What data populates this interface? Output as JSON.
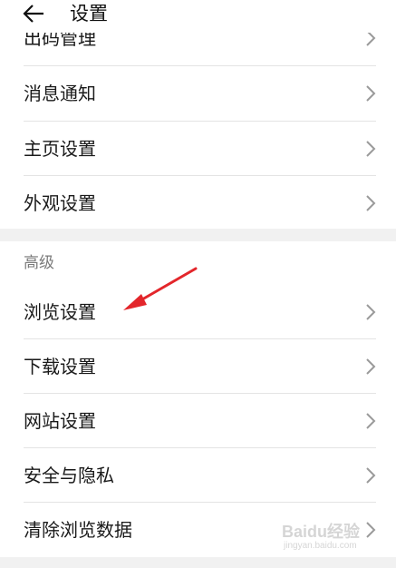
{
  "header": {
    "back_icon": "arrow-left-icon",
    "title": "设置"
  },
  "group1": {
    "items": [
      {
        "label": "出码管理"
      },
      {
        "label": "消息通知"
      },
      {
        "label": "主页设置"
      },
      {
        "label": "外观设置"
      }
    ]
  },
  "group2": {
    "section_title": "高级",
    "items": [
      {
        "label": "浏览设置"
      },
      {
        "label": "下载设置"
      },
      {
        "label": "网站设置"
      },
      {
        "label": "安全与隐私"
      },
      {
        "label": "清除浏览数据"
      }
    ]
  },
  "annotation": {
    "arrow_color": "#e3262b"
  },
  "watermark": {
    "text": "Baidu经验",
    "sub": "jingyan.baidu.com"
  },
  "colors": {
    "background": "#f1f1f1",
    "card": "#ffffff",
    "divider": "#e4e4e4",
    "chevron": "#9a9a9a"
  }
}
